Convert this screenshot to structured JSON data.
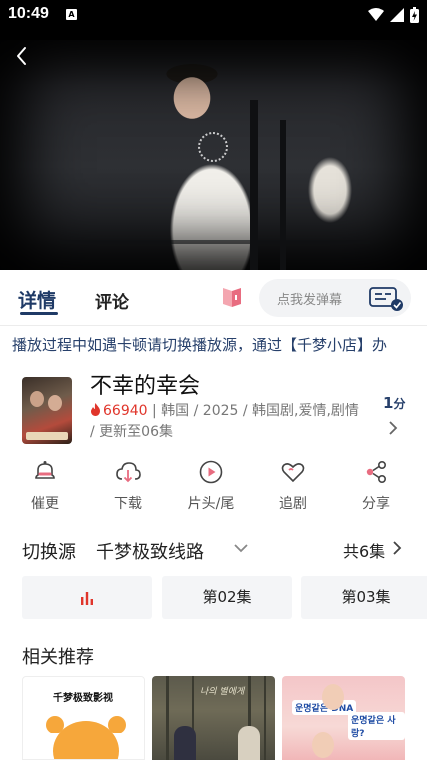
{
  "status_bar": {
    "time": "10:49",
    "sim_label": "A"
  },
  "tabs": {
    "detail": "详情",
    "comments": "评论"
  },
  "danmu": {
    "placeholder": "点我发弹幕"
  },
  "notice": "播放过程中如遇卡顿请切换播放源，通过【千梦小店】办",
  "drama": {
    "title": "不幸的幸会",
    "heat": "66940",
    "meta": "韩国 / 2025 / 韩国剧,爱情,剧情 / 更新至06集",
    "score": "1",
    "score_unit": "分"
  },
  "actions": [
    {
      "label": "催更",
      "icon": "bell-icon"
    },
    {
      "label": "下载",
      "icon": "cloud-download-icon"
    },
    {
      "label": "片头/尾",
      "icon": "play-circle-icon"
    },
    {
      "label": "追剧",
      "icon": "heart-icon"
    },
    {
      "label": "分享",
      "icon": "share-icon"
    }
  ],
  "source": {
    "label": "切换源",
    "name": "千梦极致线路",
    "total": "共6集"
  },
  "episodes": [
    "第02集",
    "第03集"
  ],
  "recommend": {
    "title": "相关推荐",
    "card1_text": "千梦极致影视",
    "card2_text": "나의 별에게",
    "card3_line1": "운명같은 DNA",
    "card3_line2": "운명같은 사랑?"
  },
  "colors": {
    "accent": "#1f3a66",
    "hot": "#e0352b",
    "highlight": "#e0352b"
  }
}
